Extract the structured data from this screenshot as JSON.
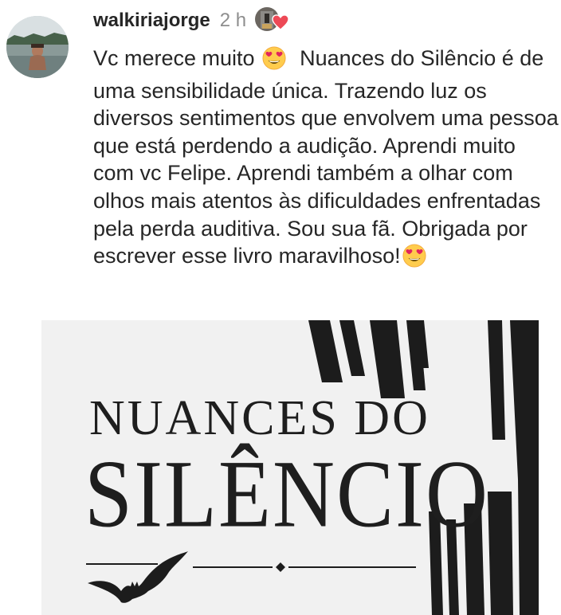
{
  "comment": {
    "username": "walkiriajorge",
    "timestamp": "2 h",
    "text_part_1": "Vc merece muito ",
    "text_part_2": "  Nuances do Silêncio é de uma sensibilidade única. Trazendo luz os diversos sentimentos que envolvem uma pessoa que está perdendo a audição. Aprendi muito com vc Felipe. Aprendi também a olhar com olhos mais atentos às dificuldades enfrentadas pela perda auditiva. Sou sua fã. Obrigada por escrever esse livro maravilhoso!",
    "emoji": "heart-eyes-emoji"
  },
  "like_badge": {
    "icon": "heart-icon",
    "color": "#ed4956"
  },
  "book_cover": {
    "title_line_1": "NUANCES DO",
    "title_line_2": "SILÊNCIO",
    "ornament_icon": "bat-icon"
  }
}
